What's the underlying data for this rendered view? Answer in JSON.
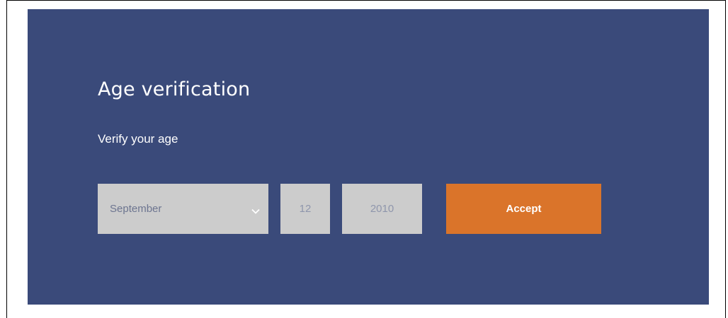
{
  "age_gate": {
    "title": "Age verification",
    "subtitle": "Verify your age",
    "month": {
      "selected": "September",
      "icon": "chevron-down-icon"
    },
    "day": {
      "value": "12"
    },
    "year": {
      "value": "2010"
    },
    "accept_label": "Accept"
  },
  "colors": {
    "panel_background": "#3a4a7a",
    "field_background": "#cccccc",
    "accept_background": "#da742a",
    "text_light": "#ffffff"
  }
}
